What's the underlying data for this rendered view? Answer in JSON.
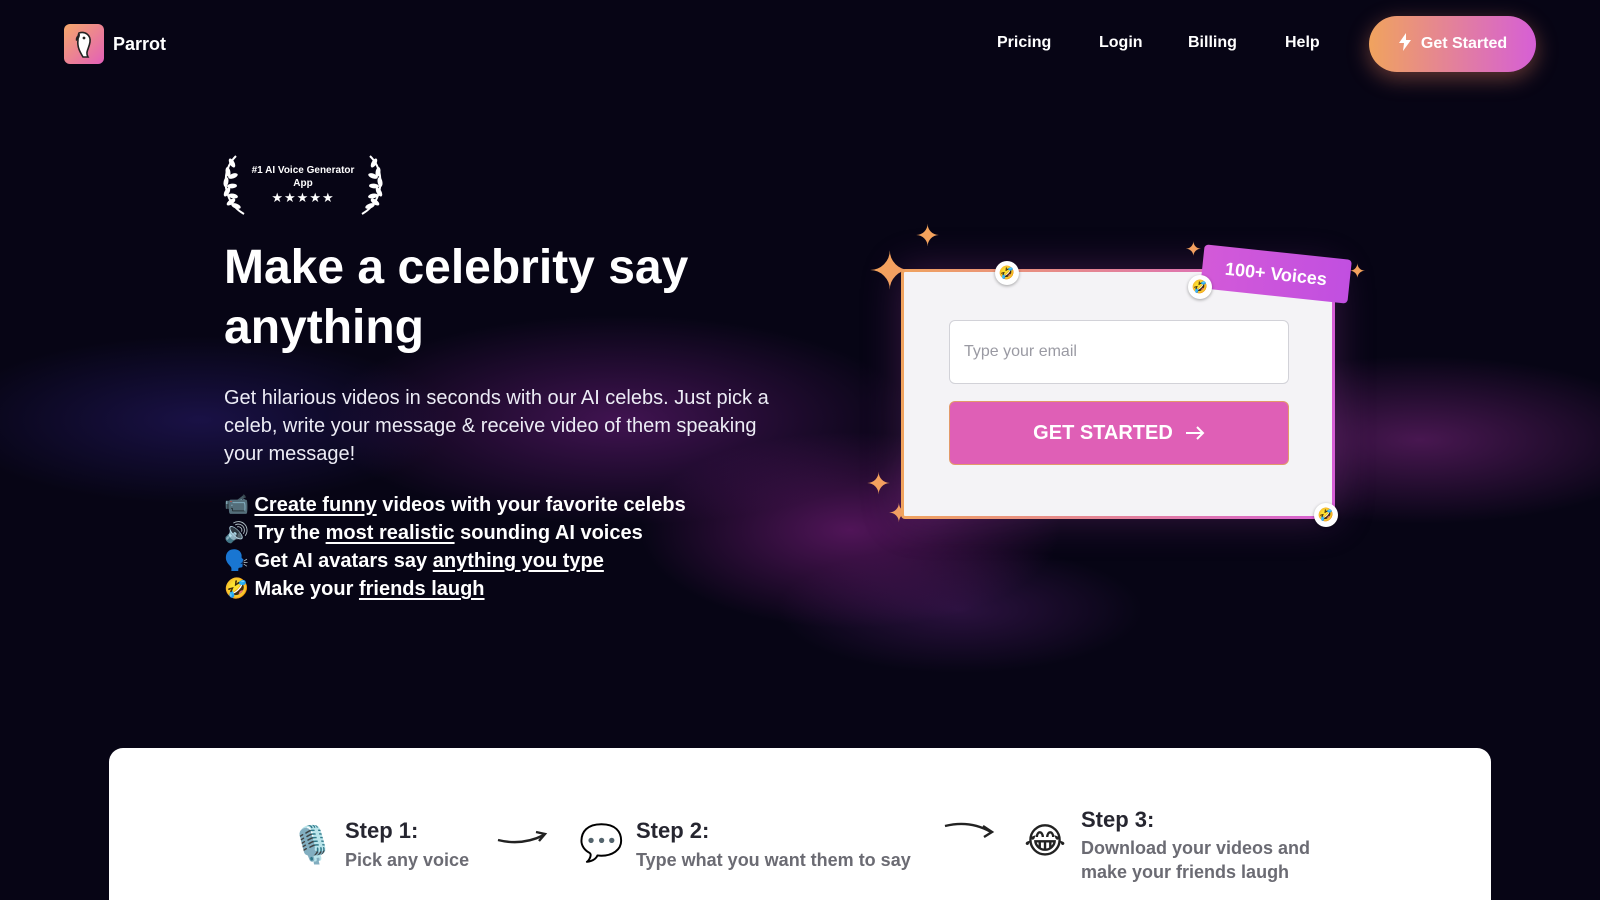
{
  "brand": {
    "name": "Parrot",
    "logo_icon": "parrot-icon"
  },
  "nav": {
    "links": [
      "Pricing",
      "Login",
      "Billing",
      "Help"
    ],
    "cta_label": "Get Started",
    "cta_icon": "lightning-bolt-icon"
  },
  "award": {
    "text": "#1 AI Voice Generator App",
    "stars": "★★★★★"
  },
  "hero": {
    "headline": "Make a celebrity say anything",
    "subhead": "Get hilarious videos in seconds with our AI celebs. Just pick a celeb, write your message & receive video of them speaking your message!",
    "features": [
      {
        "icon": "📹",
        "before": "",
        "link": "Create funny",
        "after": " videos with your favorite celebs"
      },
      {
        "icon": "🔊",
        "before": "Try the ",
        "link": "most realistic",
        "after": " sounding AI voices"
      },
      {
        "icon": "🗣️",
        "before": "Get AI avatars say ",
        "link": "anything you type",
        "after": ""
      },
      {
        "icon": "🤣",
        "before": "Make your ",
        "link": "friends laugh",
        "after": ""
      }
    ]
  },
  "form": {
    "email_placeholder": "Type your email",
    "email_value": "",
    "button_label": "GET STARTED",
    "button_icon": "arrow-right-icon",
    "badge": "100+ Voices",
    "emoji": "🤣"
  },
  "steps": [
    {
      "icon": "🎙️",
      "title": "Step 1:",
      "desc": "Pick any voice"
    },
    {
      "icon": "💬",
      "title": "Step 2:",
      "desc": "Type what you want them to say"
    },
    {
      "icon": "😂",
      "title": "Step 3:",
      "desc": "Download your videos and make your friends laugh"
    }
  ],
  "colors": {
    "background": "#070515",
    "accent_orange": "#f0a35e",
    "accent_pink": "#df5fb6",
    "accent_purple": "#c14fe0"
  }
}
